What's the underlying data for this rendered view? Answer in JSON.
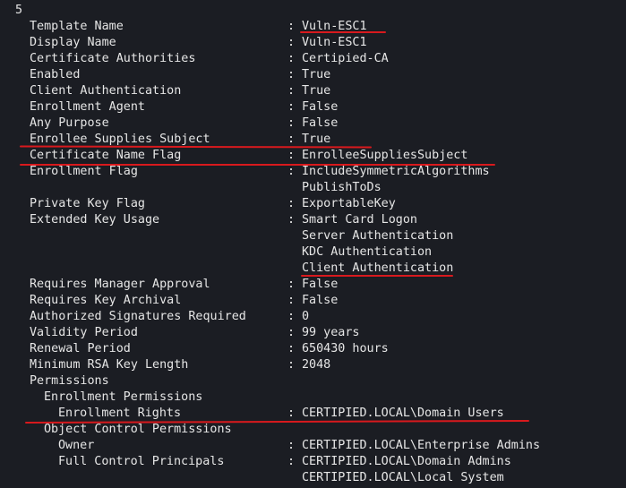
{
  "terminal": {
    "index": "5",
    "separator": ":",
    "rows": [
      {
        "key": "Template Name",
        "value": "Vuln-ESC1",
        "indent": 0
      },
      {
        "key": "Display Name",
        "value": "Vuln-ESC1",
        "indent": 0
      },
      {
        "key": "Certificate Authorities",
        "value": "Certipied-CA",
        "indent": 0
      },
      {
        "key": "Enabled",
        "value": "True",
        "indent": 0
      },
      {
        "key": "Client Authentication",
        "value": "True",
        "indent": 0
      },
      {
        "key": "Enrollment Agent",
        "value": "False",
        "indent": 0
      },
      {
        "key": "Any Purpose",
        "value": "False",
        "indent": 0
      },
      {
        "key": "Enrollee Supplies Subject",
        "value": "True",
        "indent": 0
      },
      {
        "key": "Certificate Name Flag",
        "value": "EnrolleeSuppliesSubject",
        "indent": 0
      },
      {
        "key": "Enrollment Flag",
        "value": "IncludeSymmetricAlgorithms",
        "indent": 0
      },
      {
        "key": "",
        "value": "PublishToDs",
        "indent": 0
      },
      {
        "key": "Private Key Flag",
        "value": "ExportableKey",
        "indent": 0
      },
      {
        "key": "Extended Key Usage",
        "value": "Smart Card Logon",
        "indent": 0
      },
      {
        "key": "",
        "value": "Server Authentication",
        "indent": 0
      },
      {
        "key": "",
        "value": "KDC Authentication",
        "indent": 0
      },
      {
        "key": "",
        "value": "Client Authentication",
        "indent": 0
      },
      {
        "key": "Requires Manager Approval",
        "value": "False",
        "indent": 0
      },
      {
        "key": "Requires Key Archival",
        "value": "False",
        "indent": 0
      },
      {
        "key": "Authorized Signatures Required",
        "value": "0",
        "indent": 0
      },
      {
        "key": "Validity Period",
        "value": "99 years",
        "indent": 0
      },
      {
        "key": "Renewal Period",
        "value": "650430 hours",
        "indent": 0
      },
      {
        "key": "Minimum RSA Key Length",
        "value": "2048",
        "indent": 0
      },
      {
        "key": "Permissions",
        "value": "",
        "indent": 0
      },
      {
        "key": "Enrollment Permissions",
        "value": "",
        "indent": 1
      },
      {
        "key": "Enrollment Rights",
        "value": "CERTIPIED.LOCAL\\Domain Users",
        "indent": 2
      },
      {
        "key": "Object Control Permissions",
        "value": "",
        "indent": 1
      },
      {
        "key": "Owner",
        "value": "CERTIPIED.LOCAL\\Enterprise Admins",
        "indent": 2
      },
      {
        "key": "Full Control Principals",
        "value": "CERTIPIED.LOCAL\\Domain Admins",
        "indent": 2
      },
      {
        "key": "",
        "value": "CERTIPIED.LOCAL\\Local System",
        "indent": 0
      }
    ]
  },
  "colors": {
    "background": "#1b1d23",
    "text": "#e6e6e6",
    "highlight": "#d8191d"
  }
}
